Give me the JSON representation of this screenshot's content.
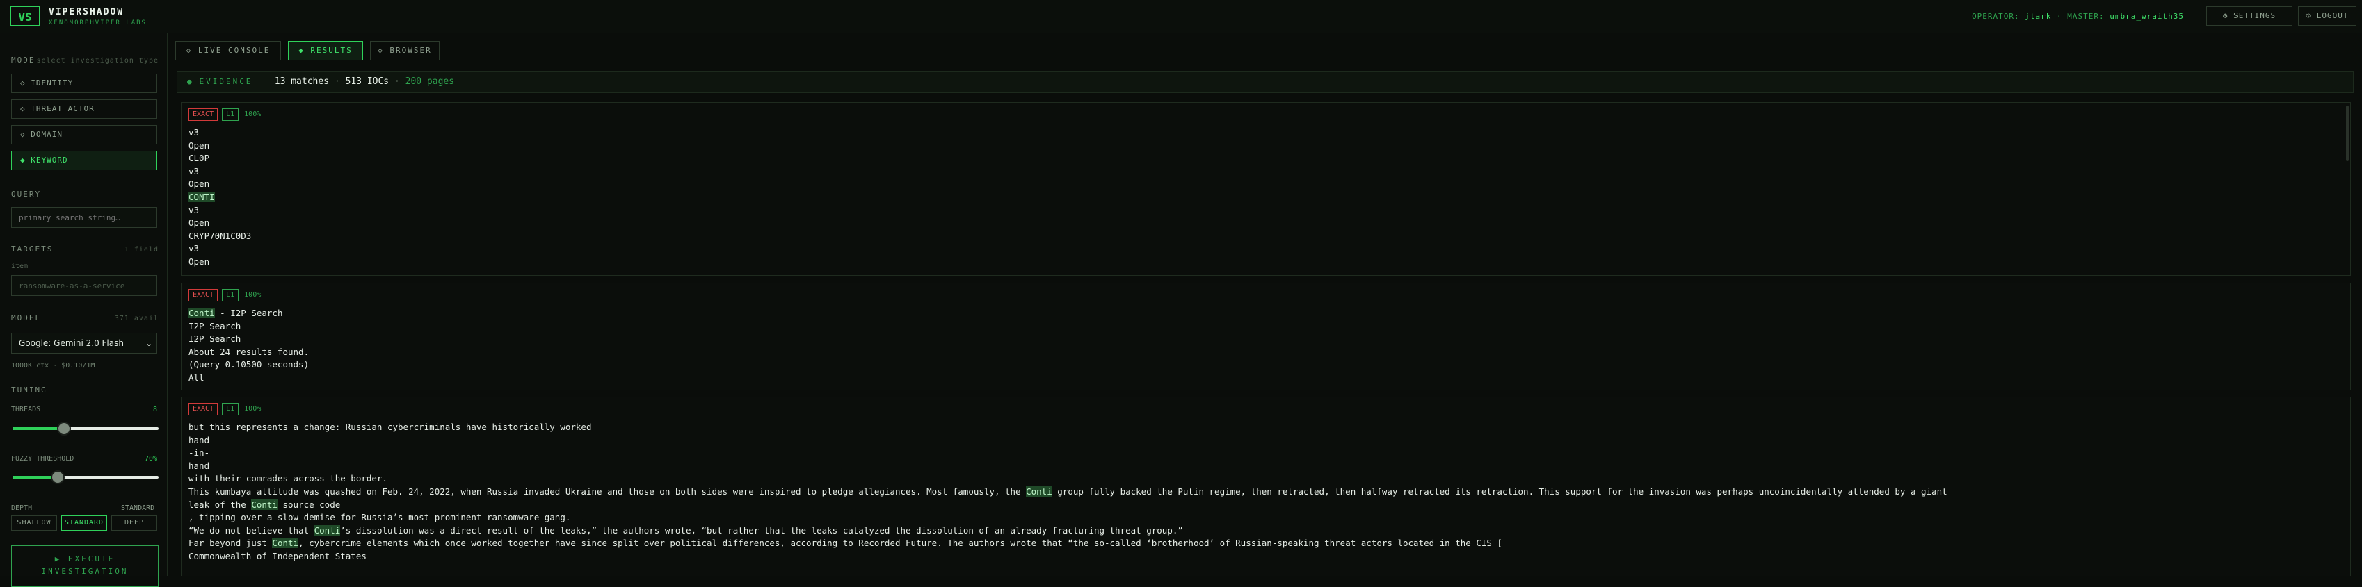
{
  "header": {
    "logo": "VS",
    "brand": "VIPERSHADOW",
    "brand_sub": "XENOMORPHVIPER LABS",
    "operator_label": "OPERATOR:",
    "operator_value": "jtark",
    "master_label": "· MASTER:",
    "master_value": "umbra_wraith35",
    "settings_label": "⚙ SETTINGS",
    "logout_label": "⎋ LOGOUT"
  },
  "sidebar": {
    "mode_title": "MODE",
    "mode_hint": "select investigation type",
    "modes": [
      {
        "label": "◇ IDENTITY",
        "active": false
      },
      {
        "label": "◇ THREAT ACTOR",
        "active": false
      },
      {
        "label": "◇ DOMAIN",
        "active": false
      },
      {
        "label": "◆ KEYWORD",
        "active": true
      }
    ],
    "query_title": "QUERY",
    "query_placeholder": "primary search string…",
    "targets_title": "TARGETS",
    "targets_count": "1 field",
    "targets_field_label": "item",
    "targets_value": "ransomware-as-a-service",
    "model_title": "MODEL",
    "model_count": "371 avail",
    "model_value": "Google: Gemini 2.0 Flash",
    "model_stats": "1000K ctx · $0.10/1M",
    "tuning_title": "TUNING",
    "threads_label": "THREADS",
    "threads_value": "8",
    "threads_fraction": 0.35,
    "fuzzy_label": "FUZZY THRESHOLD",
    "fuzzy_value": "70%",
    "fuzzy_fraction": 0.31,
    "depth_label": "DEPTH",
    "depth_value": "STANDARD",
    "depth_options": [
      "SHALLOW",
      "STANDARD",
      "DEEP"
    ],
    "execute_label": "▶ EXECUTE INVESTIGATION"
  },
  "tabs": [
    {
      "label": "◇ LIVE CONSOLE",
      "active": false
    },
    {
      "label": "◆ RESULTS",
      "active": true
    },
    {
      "label": "◇ BROWSER",
      "active": false
    }
  ],
  "evidence": {
    "label": "EVIDENCE",
    "matches": "13 matches",
    "iocs": "513 IOCs",
    "pages": "200 pages"
  },
  "results": [
    {
      "match": "EXACT",
      "level": "L1",
      "score": "100%",
      "lines": [
        "v3",
        "Open",
        "CL0P",
        "v3",
        "Open",
        "CONTI",
        "v3",
        "Open",
        "CRYP70N1C0D3",
        "v3",
        "Open"
      ]
    },
    {
      "match": "EXACT",
      "level": "L1",
      "score": "100%",
      "lines": [
        "Conti - I2P Search",
        "I2P Search",
        "I2P Search",
        "About 24 results found.",
        "(Query 0.10500 seconds)",
        "All"
      ]
    },
    {
      "match": "EXACT",
      "level": "L1",
      "score": "100%",
      "lines": [
        "but this represents a change: Russian cybercriminals have historically worked",
        "hand",
        "-in-",
        "hand",
        "with their comrades across the border.",
        "This kumbaya attitude was quashed on Feb. 24, 2022, when Russia invaded Ukraine and those on both sides were inspired to pledge allegiances. Most famously, the Conti group fully backed the Putin regime, then retracted, then halfway retracted its retraction. This support for the invasion was perhaps uncoincidentally attended by a giant",
        "leak of the Conti source code",
        ", tipping over a slow demise for Russia’s most prominent ransomware gang.",
        "“We do not believe that Conti’s dissolution was a direct result of the leaks,” the authors wrote, “but rather that the leaks catalyzed the dissolution of an already fracturing threat group.”",
        "Far beyond just Conti, cybercrime elements which once worked together have since split over political differences, according to Recorded Future. The authors wrote that “the so-called ‘brotherhood’ of Russian-speaking threat actors located in the CIS [",
        "Commonwealth of Independent States"
      ]
    }
  ],
  "highlight_terms": [
    "CONTI",
    "Conti"
  ]
}
